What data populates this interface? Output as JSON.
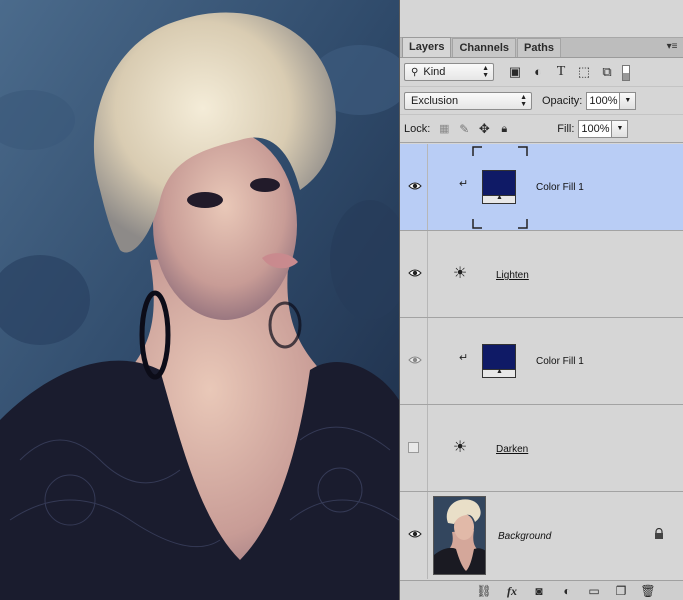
{
  "tabs": [
    {
      "label": "Layers",
      "active": true
    },
    {
      "label": "Channels",
      "active": false
    },
    {
      "label": "Paths",
      "active": false
    }
  ],
  "panel_menu_icon": "panel-menu-icon",
  "filter": {
    "kind_label": "Kind",
    "icons": [
      "image-filter-icon",
      "adjustment-filter-icon",
      "type-filter-icon",
      "shape-filter-icon",
      "smart-object-filter-icon",
      "filter-toggle-icon"
    ]
  },
  "blend": {
    "mode": "Exclusion",
    "opacity_label": "Opacity:",
    "opacity_value": "100%"
  },
  "lock": {
    "label": "Lock:",
    "fill_label": "Fill:",
    "fill_value": "100%",
    "icons": [
      "lock-transparent-icon",
      "lock-image-icon",
      "lock-position-icon",
      "lock-all-icon"
    ]
  },
  "layers": [
    {
      "name": "Color Fill 1",
      "type": "fill",
      "visible": true,
      "clipped": true,
      "selected": true,
      "fill_color": "#0f1a66"
    },
    {
      "name": "Lighten",
      "type": "adjustment",
      "visible": true,
      "clipped": false,
      "selected": false
    },
    {
      "name": "Color Fill 1",
      "type": "fill",
      "visible": true,
      "dimmed_eye": true,
      "clipped": true,
      "selected": false,
      "fill_color": "#0f1a66"
    },
    {
      "name": "Darken",
      "type": "adjustment",
      "visible": false,
      "clipped": false,
      "selected": false
    },
    {
      "name": "Background",
      "type": "background",
      "visible": true,
      "locked": true,
      "selected": false
    }
  ],
  "footer_icons": [
    "link-layers-icon",
    "fx-icon",
    "add-mask-icon",
    "new-adjustment-icon",
    "new-group-icon",
    "new-layer-icon",
    "delete-layer-icon"
  ],
  "footer_fx_label": "fx",
  "colors": {
    "selection": "#b9cdf5",
    "fill_swatch": "#0f1a66",
    "panel_bg": "#d6d6d6"
  }
}
